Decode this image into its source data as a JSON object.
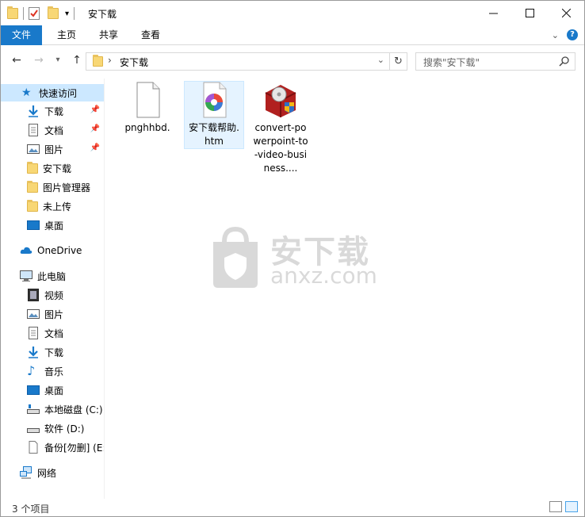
{
  "window": {
    "title": "安下载"
  },
  "titlebar": {
    "minimize_icon": "minimize-icon",
    "maximize_icon": "maximize-icon",
    "close_icon": "close-icon"
  },
  "ribbon": {
    "tabs": [
      {
        "label": "文件"
      },
      {
        "label": "主页"
      },
      {
        "label": "共享"
      },
      {
        "label": "查看"
      }
    ]
  },
  "addressbar": {
    "path": "安下载"
  },
  "search": {
    "placeholder": "搜索\"安下载\""
  },
  "sidebar": {
    "quick_access": {
      "label": "快速访问"
    },
    "items": [
      {
        "label": "下载",
        "icon": "download-icon",
        "pinned": true
      },
      {
        "label": "文档",
        "icon": "document-icon",
        "pinned": true
      },
      {
        "label": "图片",
        "icon": "picture-icon",
        "pinned": true
      },
      {
        "label": "安下载",
        "icon": "folder-icon",
        "pinned": false
      },
      {
        "label": "图片管理器",
        "icon": "folder-icon",
        "pinned": false
      },
      {
        "label": "未上传",
        "icon": "folder-icon",
        "pinned": false
      },
      {
        "label": "桌面",
        "icon": "desktop-icon",
        "pinned": false
      }
    ],
    "onedrive": {
      "label": "OneDrive"
    },
    "thispc": {
      "label": "此电脑"
    },
    "pc_items": [
      {
        "label": "视频",
        "icon": "video-icon"
      },
      {
        "label": "图片",
        "icon": "picture-icon"
      },
      {
        "label": "文档",
        "icon": "document-icon"
      },
      {
        "label": "下载",
        "icon": "download-icon"
      },
      {
        "label": "音乐",
        "icon": "music-icon"
      },
      {
        "label": "桌面",
        "icon": "desktop-icon"
      },
      {
        "label": "本地磁盘 (C:)",
        "icon": "drive-icon"
      },
      {
        "label": "软件 (D:)",
        "icon": "drive-icon"
      },
      {
        "label": "备份[勿删] (E:",
        "icon": "file-icon"
      }
    ],
    "network": {
      "label": "网络"
    }
  },
  "files": [
    {
      "name": "pnghhbd.",
      "icon": "blank-file-icon"
    },
    {
      "name": "安下载帮助.htm",
      "icon": "htm-file-icon"
    },
    {
      "name": "convert-powerpoint-to-video-business....",
      "icon": "installer-icon"
    }
  ],
  "watermark": {
    "cn": "安下载",
    "en": "anxz.com"
  },
  "status": {
    "item_count": "3 个项目"
  }
}
